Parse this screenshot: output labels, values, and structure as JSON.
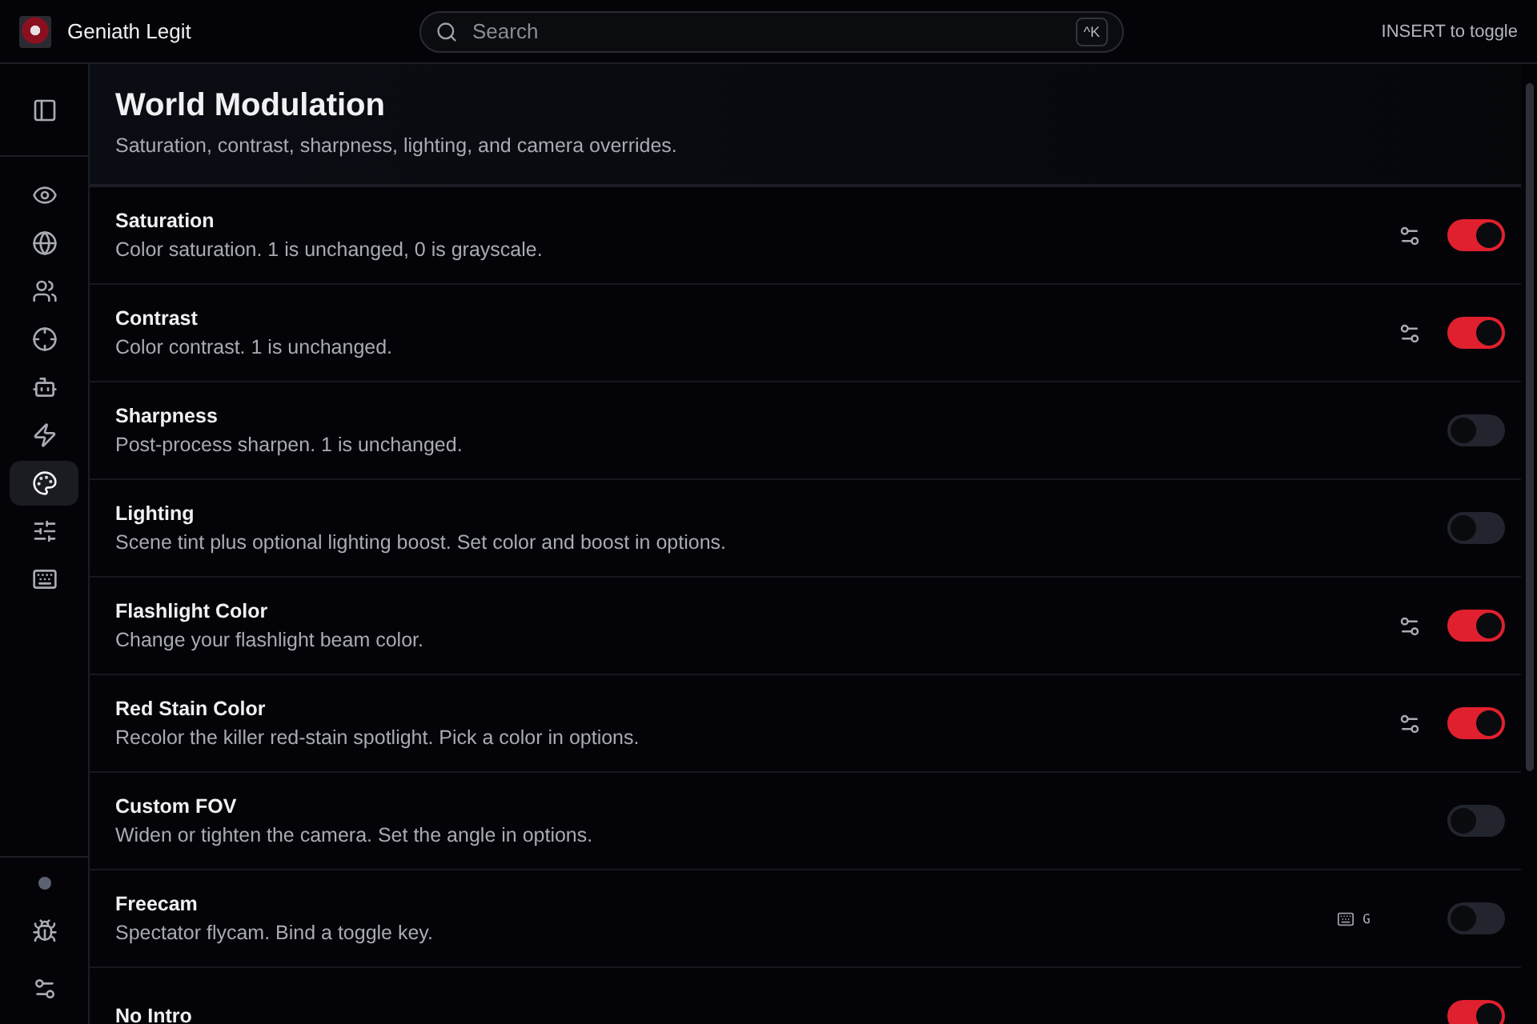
{
  "app": {
    "name": "Geniath Legit"
  },
  "search": {
    "placeholder": "Search",
    "shortcut": "^K"
  },
  "hint": "INSERT to toggle",
  "sidebar": {
    "items": [
      {
        "selected": false
      },
      {
        "selected": false
      },
      {
        "selected": false
      },
      {
        "selected": false
      },
      {
        "selected": false
      },
      {
        "selected": false
      },
      {
        "selected": true
      },
      {
        "selected": false
      },
      {
        "selected": false
      }
    ]
  },
  "page": {
    "title": "World Modulation",
    "subtitle": "Saturation, contrast, sharpness, lighting, and camera overrides."
  },
  "rows": [
    {
      "title": "Saturation",
      "description": "Color saturation. 1 is unchanged, 0 is grayscale.",
      "has_options": true,
      "on": true
    },
    {
      "title": "Contrast",
      "description": "Color contrast. 1 is unchanged.",
      "has_options": true,
      "on": true
    },
    {
      "title": "Sharpness",
      "description": "Post-process sharpen. 1 is unchanged.",
      "has_options": false,
      "on": false
    },
    {
      "title": "Lighting",
      "description": "Scene tint plus optional lighting boost. Set color and boost in options.",
      "has_options": false,
      "on": false
    },
    {
      "title": "Flashlight Color",
      "description": "Change your flashlight beam color.",
      "has_options": true,
      "on": true
    },
    {
      "title": "Red Stain Color",
      "description": "Recolor the killer red-stain spotlight. Pick a color in options.",
      "has_options": true,
      "on": true
    },
    {
      "title": "Custom FOV",
      "description": "Widen or tighten the camera. Set the angle in options.",
      "has_options": false,
      "on": false
    },
    {
      "title": "Freecam",
      "description": "Spectator flycam. Bind a toggle key.",
      "has_options": false,
      "keybind": "G",
      "on": false
    },
    {
      "title": "No Intro",
      "has_options": false,
      "on": true
    }
  ]
}
